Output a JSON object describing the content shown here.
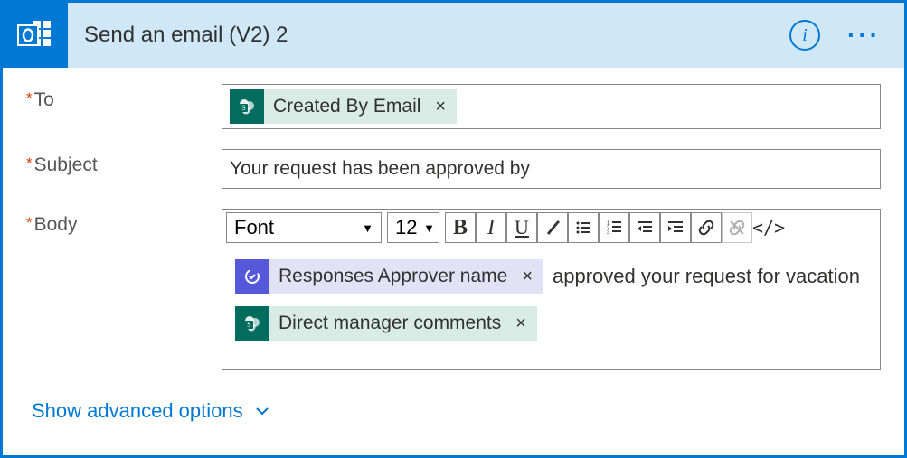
{
  "header": {
    "title": "Send an email (V2) 2",
    "info_tooltip": "Info",
    "more_tooltip": "More"
  },
  "fields": {
    "to": {
      "label": "To",
      "required": true,
      "tokens": [
        {
          "kind": "sp",
          "label": "Created By Email"
        }
      ]
    },
    "subject": {
      "label": "Subject",
      "required": true,
      "value": "Your request has been approved by"
    },
    "body": {
      "label": "Body",
      "required": true,
      "toolbar": {
        "font": "Font",
        "size": "12"
      },
      "lines": [
        {
          "parts": [
            {
              "type": "token",
              "kind": "ap",
              "label": "Responses Approver name"
            },
            {
              "type": "text",
              "text": " approved your request for vacation"
            }
          ]
        },
        {
          "parts": [
            {
              "type": "token",
              "kind": "sp",
              "label": "Direct manager comments"
            }
          ]
        }
      ]
    }
  },
  "advanced_link": "Show advanced options"
}
